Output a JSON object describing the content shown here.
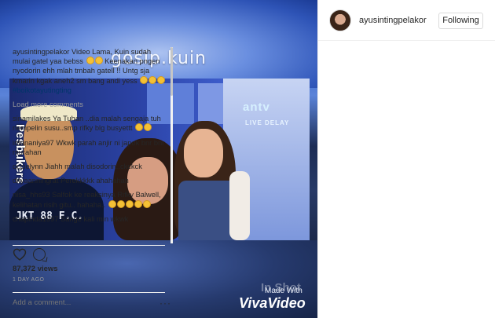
{
  "video": {
    "watermark_top": "gosip.kuin",
    "channel_logo": "antv",
    "live_label": "LIVE DELAY",
    "show_name": "Pesbukers",
    "shirt_text": "JKT 88 F.C.",
    "made_with": "Made With",
    "app_name": "VivaVideo"
  },
  "post": {
    "username": "ayusintingpelakor",
    "follow_label": "Following",
    "caption_user": "ayusintingpelakor",
    "caption_text": "Video Lama, Kuin sudah mulai gatel yaa bebss",
    "caption_text_2": "Keenakan pngen nyodorin ehh mlah tmbah gatell !! Untg sja kmarin kgak aneh2 sm bang andi yess",
    "hashtag": "#boikotayutingting",
    "load_more": "Load more comments",
    "comments": [
      {
        "user": "sinamilakes",
        "text": "Ya Tuhan ..dia malah sengaja tuh nempelin susu..smp rifky blg busyettt"
      },
      {
        "user": "intananiya97",
        "text": "Wkwk parah anjir ni japok bnr bnr murahan"
      },
      {
        "user": "occielynn",
        "text": "Jiahh malah disodorin..ckckck"
      },
      {
        "user": "dityaanningrat",
        "text": "Perekkkkk ahahahah"
      },
      {
        "user": "nisa_hhs93",
        "text": "Salfok ke reaksinya Rifky Balwell, kelihatan risih gitu.. hahaha.."
      },
      {
        "user": "chapinda1997",
        "text": "Sange kali min wkwk"
      }
    ],
    "views": "87,372 views",
    "time_ago": "1 DAY AGO",
    "add_comment_placeholder": "Add a comment...",
    "more_label": "···"
  },
  "icons": {
    "like": "heart-icon",
    "comment": "comment-bubble-icon",
    "more": "more-options-icon"
  }
}
